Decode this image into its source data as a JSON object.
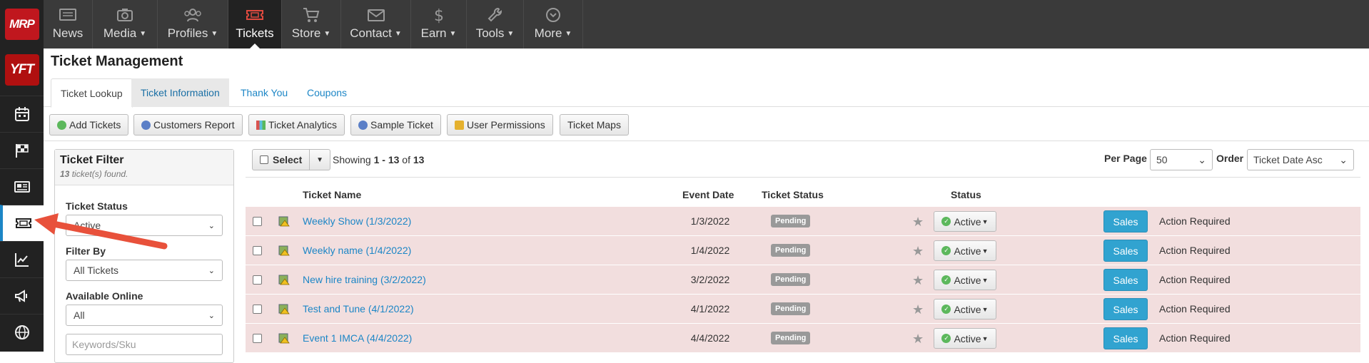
{
  "brand": {
    "logo1": "MRP",
    "logo2": "YFT"
  },
  "rail": [
    {
      "icon": "calendar-icon"
    },
    {
      "icon": "checkered-flag-icon"
    },
    {
      "icon": "newspaper-icon"
    },
    {
      "icon": "ticket-icon",
      "active": true
    },
    {
      "icon": "chart-line-icon"
    },
    {
      "icon": "megaphone-icon"
    },
    {
      "icon": "globe-icon"
    }
  ],
  "nav": {
    "items": [
      {
        "label": "News",
        "caret": false
      },
      {
        "label": "Media",
        "caret": true
      },
      {
        "label": "Profiles",
        "caret": true
      },
      {
        "label": "Tickets",
        "caret": false,
        "active": true
      },
      {
        "label": "Store",
        "caret": true
      },
      {
        "label": "Contact",
        "caret": true
      },
      {
        "label": "Earn",
        "caret": true
      },
      {
        "label": "Tools",
        "caret": true
      },
      {
        "label": "More",
        "caret": true
      }
    ]
  },
  "page": {
    "title": "Ticket Management"
  },
  "tabs": [
    "Ticket Lookup",
    "Ticket Information",
    "Thank You",
    "Coupons"
  ],
  "toolbar": {
    "add_tickets": "Add Tickets",
    "customers_report": "Customers Report",
    "ticket_analytics": "Ticket Analytics",
    "sample_ticket": "Sample Ticket",
    "user_permissions": "User Permissions",
    "ticket_maps": "Ticket Maps"
  },
  "filter": {
    "title": "Ticket Filter",
    "count_number": "13",
    "count_suffix": "ticket(s) found.",
    "status_label": "Ticket Status",
    "status_value": "Active",
    "filter_by_label": "Filter By",
    "filter_by_value": "All Tickets",
    "available_label": "Available Online",
    "available_value": "All",
    "keywords_placeholder": "Keywords/Sku"
  },
  "results": {
    "select_label": "Select",
    "showing_prefix": "Showing",
    "showing_range": "1 - 13",
    "showing_of": "of",
    "showing_total": "13",
    "per_page_label": "Per Page",
    "per_page_value": "50",
    "order_label": "Order",
    "order_value": "Ticket Date Asc"
  },
  "table": {
    "headers": {
      "name": "Ticket Name",
      "date": "Event Date",
      "ticket_status": "Ticket Status",
      "status": "Status"
    },
    "rows": [
      {
        "name": "Weekly Show (1/3/2022)",
        "date": "1/3/2022",
        "ticket_status": "Pending",
        "status": "Active",
        "sales": "Sales",
        "action": "Action Required"
      },
      {
        "name": "Weekly name (1/4/2022)",
        "date": "1/4/2022",
        "ticket_status": "Pending",
        "status": "Active",
        "sales": "Sales",
        "action": "Action Required"
      },
      {
        "name": "New hire training (3/2/2022)",
        "date": "3/2/2022",
        "ticket_status": "Pending",
        "status": "Active",
        "sales": "Sales",
        "action": "Action Required"
      },
      {
        "name": "Test and Tune (4/1/2022)",
        "date": "4/1/2022",
        "ticket_status": "Pending",
        "status": "Active",
        "sales": "Sales",
        "action": "Action Required"
      },
      {
        "name": "Event 1 IMCA (4/4/2022)",
        "date": "4/4/2022",
        "ticket_status": "Pending",
        "status": "Active",
        "sales": "Sales",
        "action": "Action Required"
      }
    ]
  },
  "colors": {
    "link": "#1c86c6",
    "row_bg": "#f2dede",
    "sales_btn": "#31a3d0",
    "nav_bg": "#3a3a3a",
    "rail_bg": "#222222",
    "annotation_arrow": "#e8513b"
  }
}
